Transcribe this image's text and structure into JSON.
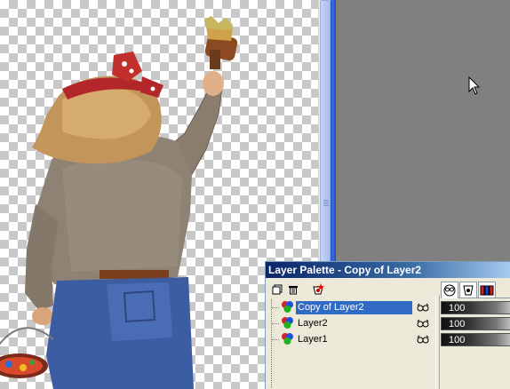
{
  "palette": {
    "title": "Layer Palette - Copy of Layer2",
    "toolbar": [
      {
        "name": "new-layer-icon"
      },
      {
        "name": "delete-layer-icon"
      },
      {
        "name": "layer-properties-icon"
      }
    ],
    "layers": [
      {
        "label": "Copy of Layer2",
        "selected": true,
        "opacity": "100"
      },
      {
        "label": "Layer2",
        "selected": false,
        "opacity": "100"
      },
      {
        "label": "Layer1",
        "selected": false,
        "opacity": "100"
      }
    ],
    "tabs": [
      {
        "name": "visibility-tab-icon"
      },
      {
        "name": "mask-tab-icon"
      },
      {
        "name": "blend-tab-icon"
      }
    ]
  },
  "colors": {
    "selection": "#316ac5",
    "workspace": "#808080",
    "title_bar_start": "#0a246a"
  }
}
